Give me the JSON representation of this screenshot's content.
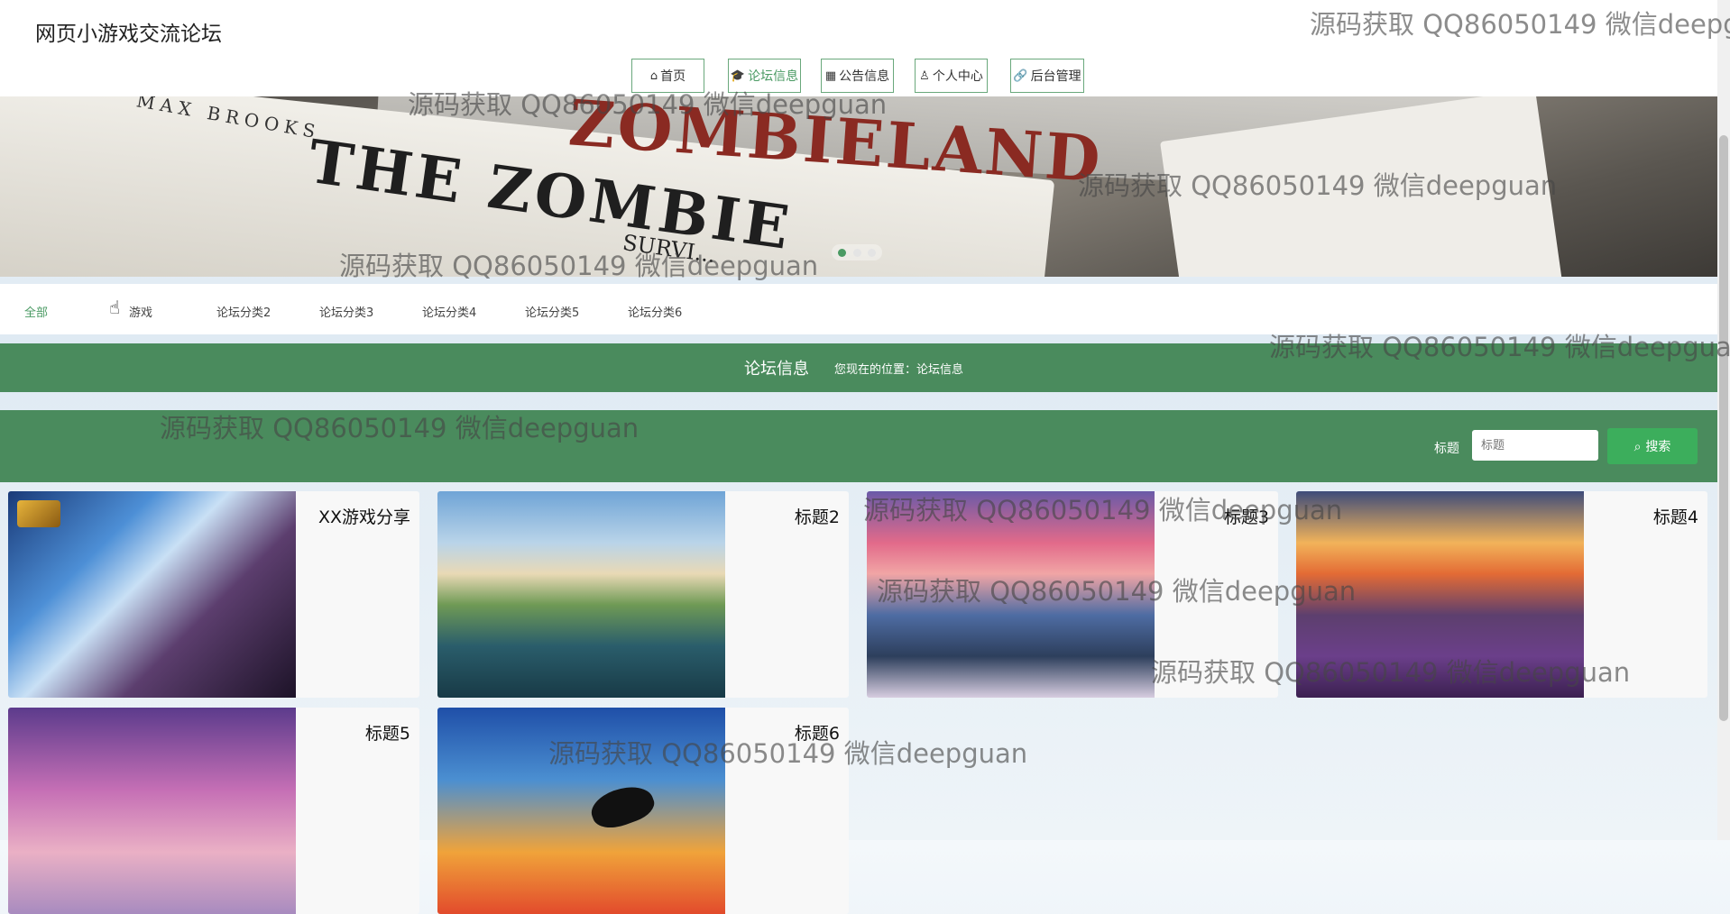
{
  "site": {
    "title": "网页小游戏交流论坛"
  },
  "nav": [
    {
      "label": "首页",
      "icon": "home-icon",
      "glyph": "⌂"
    },
    {
      "label": "论坛信息",
      "icon": "graduation-cap-icon",
      "glyph": "🎓"
    },
    {
      "label": "公告信息",
      "icon": "gift-icon",
      "glyph": "▦"
    },
    {
      "label": "个人中心",
      "icon": "user-icon",
      "glyph": "♙"
    },
    {
      "label": "后台管理",
      "icon": "link-icon",
      "glyph": "🔗"
    }
  ],
  "banner": {
    "text_author": "MAX BROOKS",
    "text_title": "THE ZOMBIE",
    "text_series": "ZOMBIELAND",
    "text_sub": "SURVI..."
  },
  "categories": [
    "全部",
    "游戏",
    "论坛分类2",
    "论坛分类3",
    "论坛分类4",
    "论坛分类5",
    "论坛分类6"
  ],
  "header_bar": {
    "heading": "论坛信息",
    "breadcrumb": "您现在的位置：论坛信息"
  },
  "search": {
    "label": "标题",
    "placeholder": "标题",
    "value": "",
    "button": "搜索",
    "icon": "search-icon"
  },
  "cards": [
    {
      "title": "XX游戏分享"
    },
    {
      "title": "标题2"
    },
    {
      "title": "标题3"
    },
    {
      "title": "标题4"
    },
    {
      "title": "标题5"
    },
    {
      "title": "标题6"
    }
  ],
  "watermark": "源码获取 QQ86050149 微信deepguan",
  "colors": {
    "accent": "#4a8b5d",
    "active": "#4a9a63",
    "search_button": "#3cae5c"
  }
}
